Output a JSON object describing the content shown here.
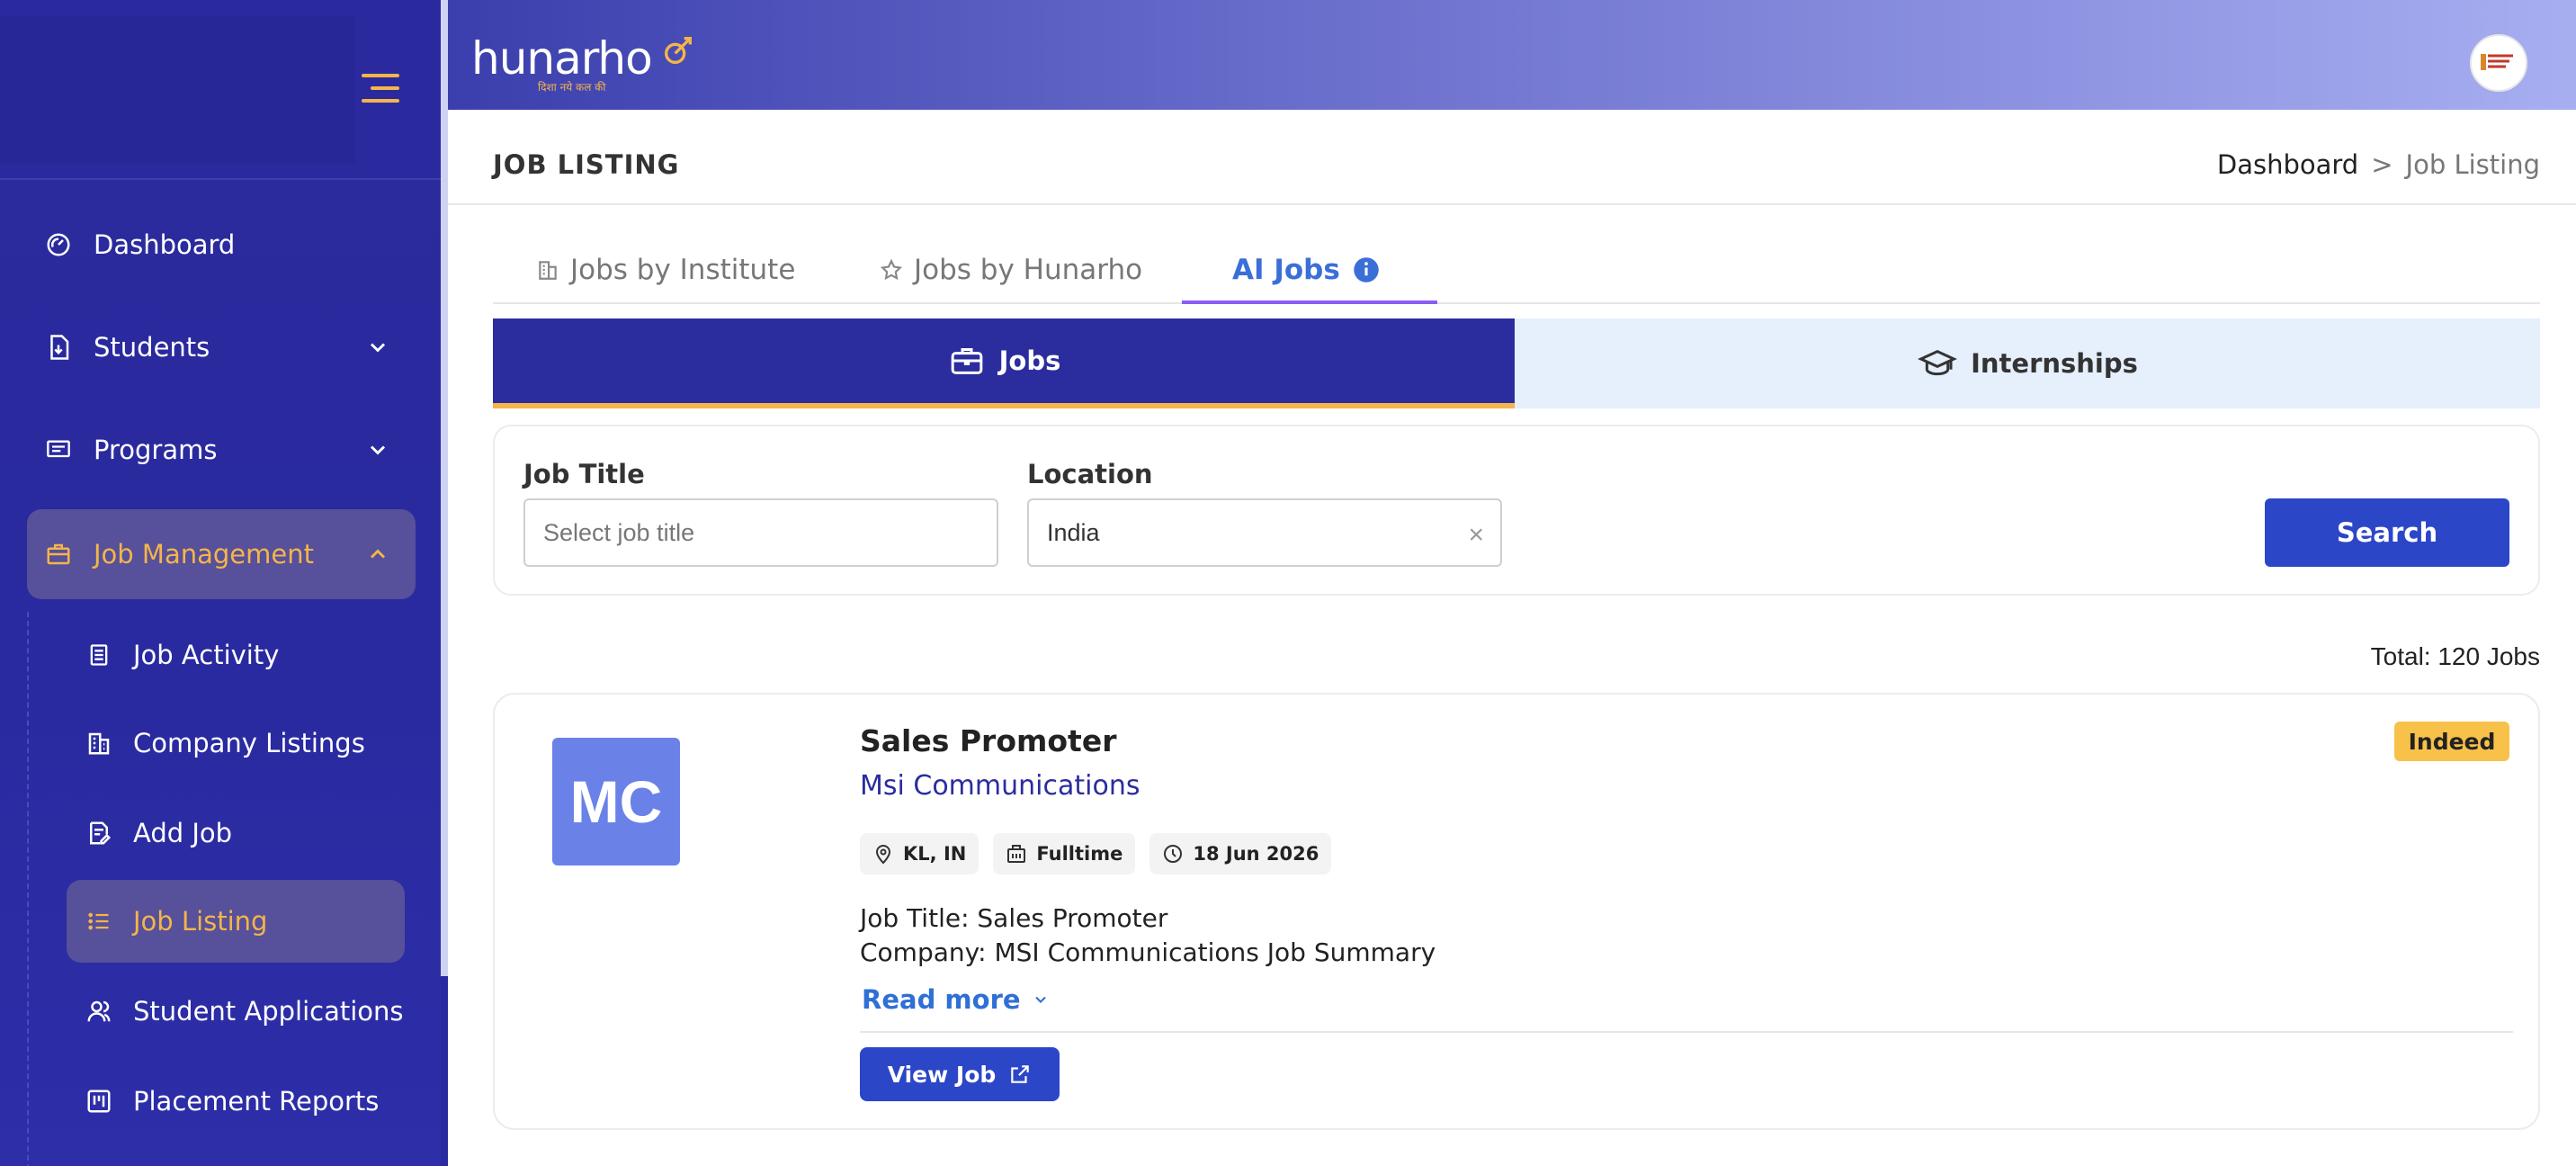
{
  "app": {
    "brand": "hunarho",
    "brand_tagline": "दिशा नये कल की"
  },
  "sidebar": {
    "items": [
      {
        "label": "Dashboard",
        "icon": "gauge-icon"
      },
      {
        "label": "Students",
        "icon": "file-download-icon"
      },
      {
        "label": "Programs",
        "icon": "monitor-icon"
      },
      {
        "label": "Job Management",
        "icon": "briefcase-icon"
      }
    ],
    "sub_items": [
      {
        "label": "Job Activity",
        "icon": "document-list-icon"
      },
      {
        "label": "Company Listings",
        "icon": "building-icon"
      },
      {
        "label": "Add Job",
        "icon": "document-edit-icon"
      },
      {
        "label": "Job Listing",
        "icon": "list-icon"
      },
      {
        "label": "Student Applications",
        "icon": "users-icon"
      },
      {
        "label": "Placement Reports",
        "icon": "report-icon"
      }
    ],
    "accent": "#f4b54a"
  },
  "page": {
    "title": "JOB LISTING",
    "breadcrumb": {
      "home": "Dashboard",
      "separator": ">",
      "current": "Job Listing"
    }
  },
  "tabs": [
    {
      "label": "Jobs by Institute",
      "icon": "building-icon"
    },
    {
      "label": "Jobs by Hunarho",
      "icon": "star-icon"
    },
    {
      "label": "AI Jobs",
      "icon": "info-icon"
    }
  ],
  "type_toggle": {
    "jobs": "Jobs",
    "internships": "Internships"
  },
  "filters": {
    "job_title_label": "Job Title",
    "job_title_placeholder": "Select job title",
    "location_label": "Location",
    "location_value": "India",
    "clear_symbol": "×",
    "search_label": "Search"
  },
  "results": {
    "total": "Total: 120 Jobs"
  },
  "jobs": [
    {
      "logo_initials": "MC",
      "title": "Sales Promoter",
      "company": "Msi Communications",
      "source": "Indeed",
      "location": "KL, IN",
      "type": "Fulltime",
      "date": "18 Jun 2026",
      "desc_line1": "Job Title: Sales Promoter",
      "desc_line2": "Company: MSI Communications Job Summary",
      "read_more": "Read more",
      "view_label": "View Job"
    }
  ],
  "colors": {
    "primary": "#2b2d9e",
    "button": "#2c46c8",
    "link": "#2f6fd6",
    "badge": "#f7c14a",
    "logo_bg": "#6a81e8"
  }
}
